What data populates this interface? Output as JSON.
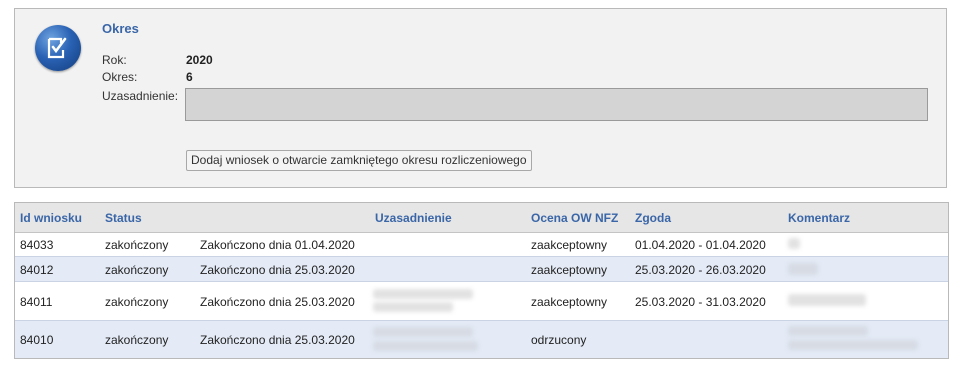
{
  "header": {
    "title": "Okres",
    "icon": "checklist-icon",
    "rok_label": "Rok:",
    "rok_value": "2020",
    "okres_label": "Okres:",
    "okres_value": "6",
    "uzasadnienie_label": "Uzasadnienie:",
    "uzasadnienie_value": "",
    "add_button_label": "Dodaj wniosek o otwarcie zamkniętego okresu rozliczeniowego"
  },
  "table": {
    "columns": [
      "Id wniosku",
      "Status",
      "Uzasadnienie",
      "Ocena OW NFZ",
      "Zgoda",
      "Komentarz"
    ],
    "rows": [
      {
        "id": "84033",
        "status": "zakończony",
        "status_detail": "Zakończono dnia 01.04.2020",
        "uzasadnienie": "",
        "ocena": "zaakceptowny",
        "zgoda": "01.04.2020 - 01.04.2020",
        "komentarz": ""
      },
      {
        "id": "84012",
        "status": "zakończony",
        "status_detail": "Zakończono dnia 25.03.2020",
        "uzasadnienie": "",
        "ocena": "zaakceptowny",
        "zgoda": "25.03.2020 - 26.03.2020",
        "komentarz": ""
      },
      {
        "id": "84011",
        "status": "zakończony",
        "status_detail": "Zakończono dnia 25.03.2020",
        "uzasadnienie": "",
        "ocena": "zaakceptowny",
        "zgoda": "25.03.2020 - 31.03.2020",
        "komentarz": ""
      },
      {
        "id": "84010",
        "status": "zakończony",
        "status_detail": "Zakończono dnia 25.03.2020",
        "uzasadnienie": "",
        "ocena": "odrzucony",
        "zgoda": "",
        "komentarz": ""
      }
    ]
  },
  "colors": {
    "accent": "#3a66a8",
    "panel_bg": "#f2f2f2",
    "row_alt": "#e4ebf6"
  }
}
